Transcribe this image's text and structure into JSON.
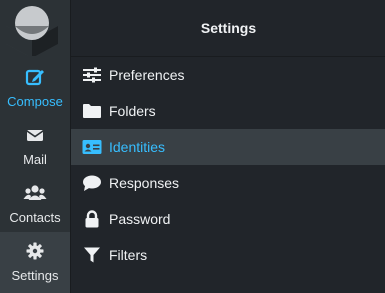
{
  "colors": {
    "accent": "#37beff",
    "rail_bg": "#2c3236",
    "active_bg": "#394045",
    "panel_bg": "#21252a",
    "text": "#f0f2f4"
  },
  "rail": {
    "items": [
      {
        "label": "Compose",
        "icon": "compose-icon"
      },
      {
        "label": "Mail",
        "icon": "envelope-icon"
      },
      {
        "label": "Contacts",
        "icon": "users-icon"
      },
      {
        "label": "Settings",
        "icon": "gear-icon"
      }
    ]
  },
  "settings": {
    "title": "Settings",
    "items": [
      {
        "label": "Preferences",
        "icon": "sliders-icon"
      },
      {
        "label": "Folders",
        "icon": "folder-icon"
      },
      {
        "label": "Identities",
        "icon": "id-card-icon"
      },
      {
        "label": "Responses",
        "icon": "comment-icon"
      },
      {
        "label": "Password",
        "icon": "lock-icon"
      },
      {
        "label": "Filters",
        "icon": "filter-icon"
      }
    ]
  }
}
